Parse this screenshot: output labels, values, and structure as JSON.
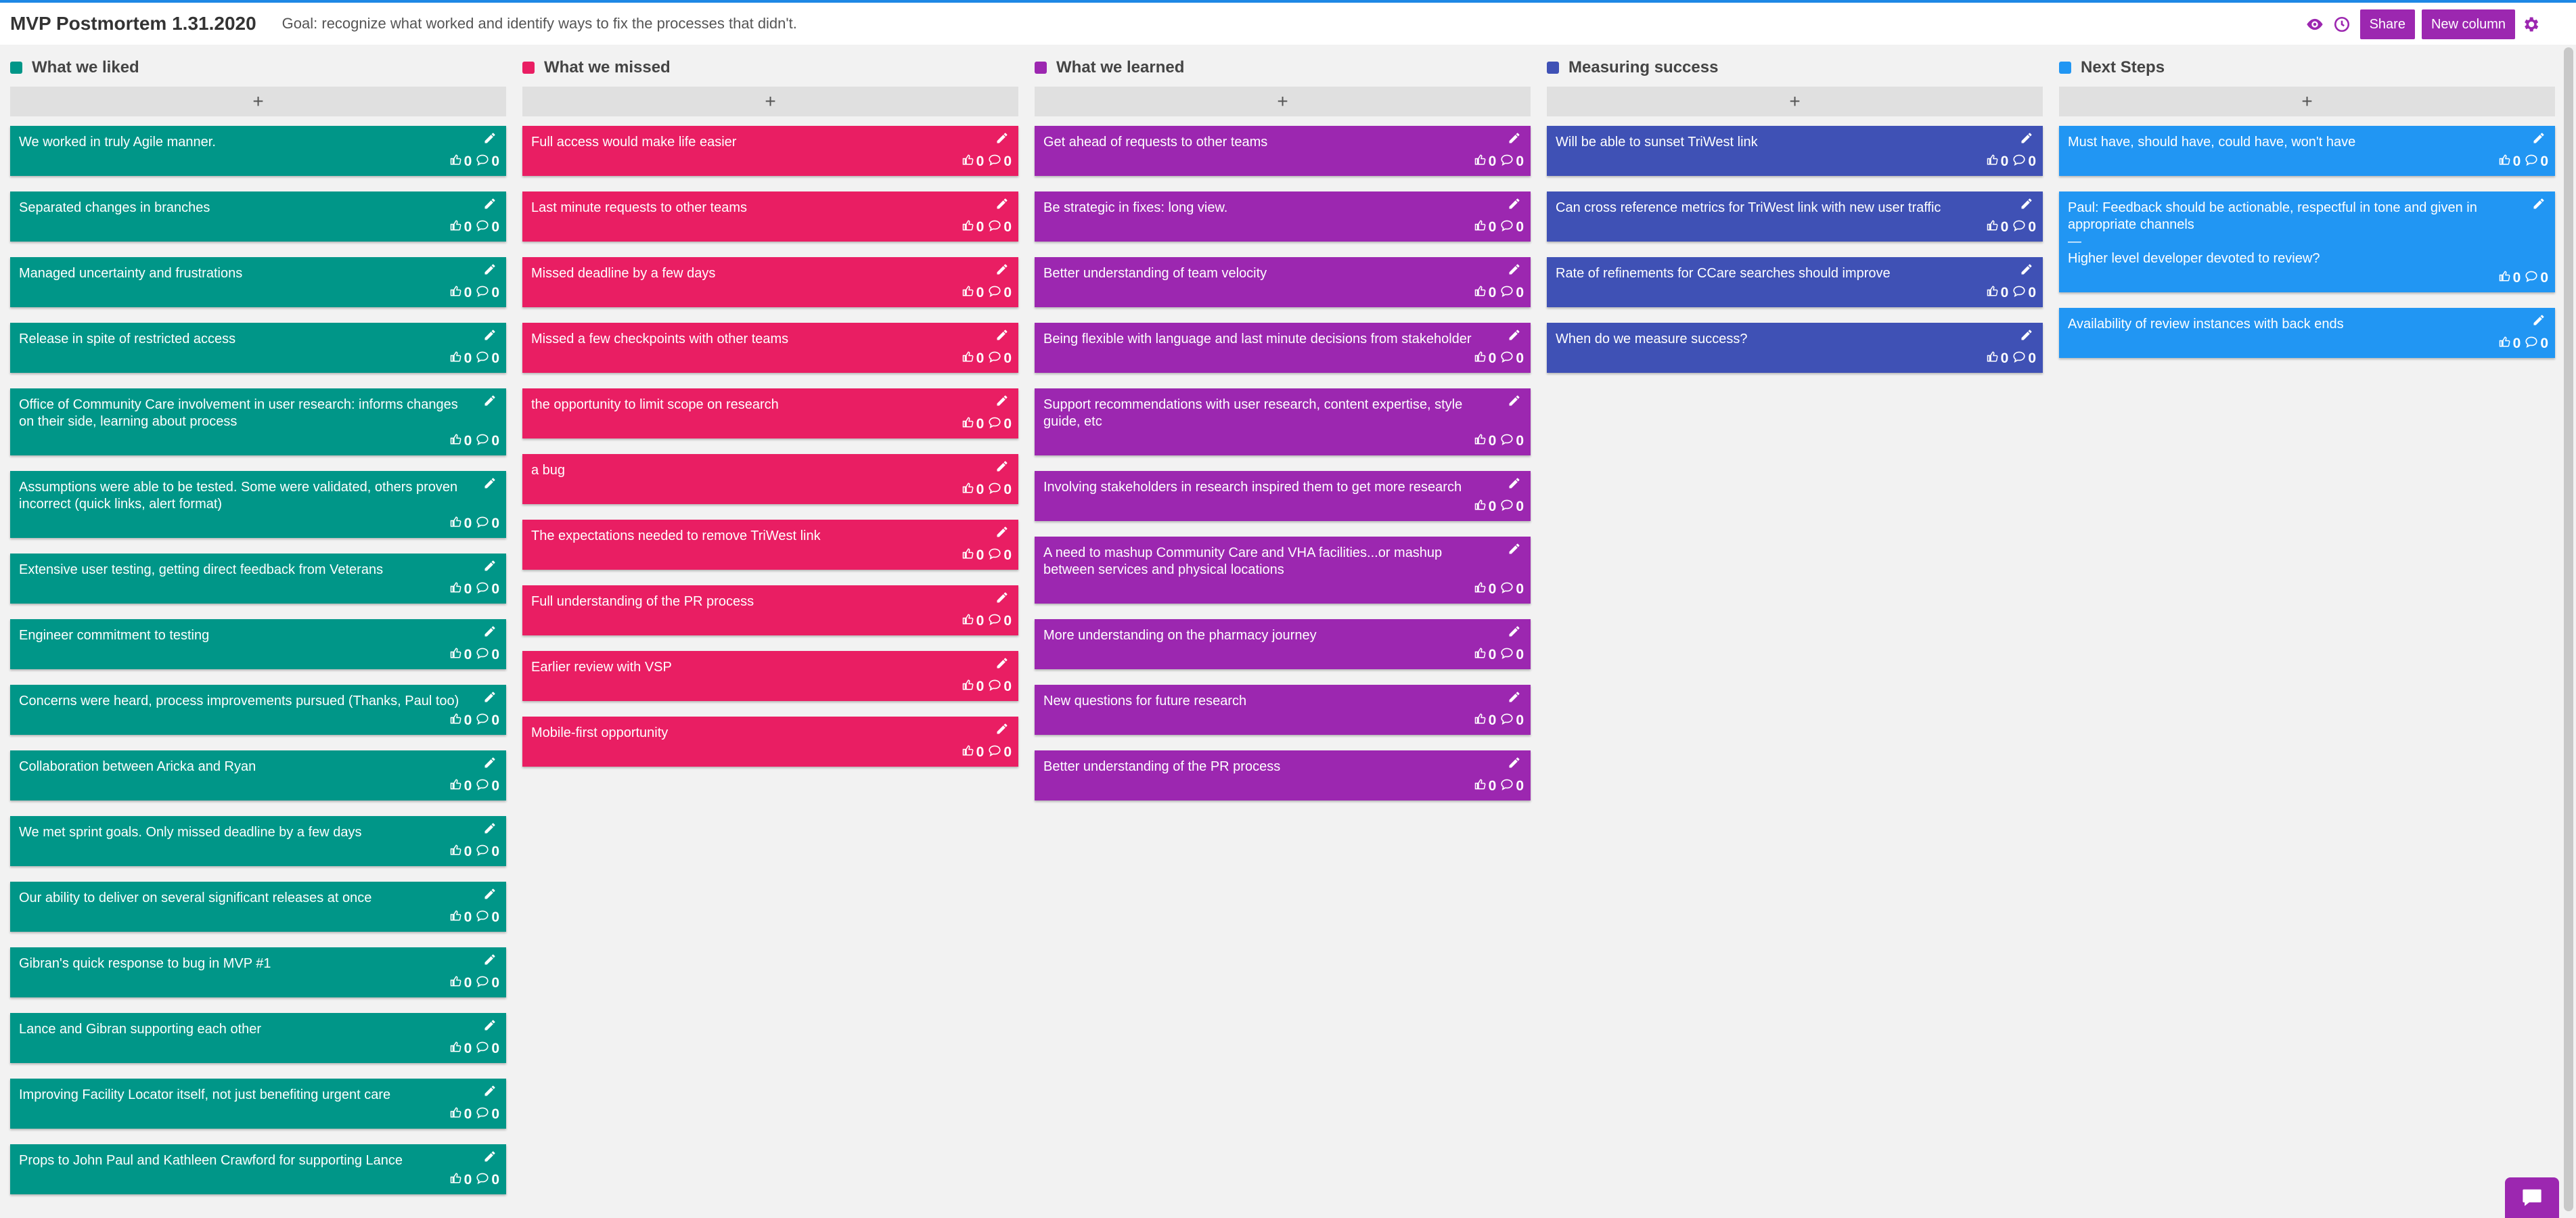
{
  "header": {
    "title": "MVP Postmortem 1.31.2020",
    "goal": "Goal: recognize what worked and identify ways to fix the processes that didn't.",
    "share_label": "Share",
    "new_column_label": "New column",
    "icons": [
      "eye-icon",
      "clock-icon",
      "gear-icon"
    ],
    "accent_color": "#9c27b0"
  },
  "add_label": "+",
  "columns": [
    {
      "title": "What we liked",
      "color": "#009688",
      "cards": [
        {
          "text": "We worked in truly Agile manner.",
          "likes": "0",
          "comments": "0"
        },
        {
          "text": "Separated changes in branches",
          "likes": "0",
          "comments": "0"
        },
        {
          "text": "Managed uncertainty and frustrations",
          "likes": "0",
          "comments": "0"
        },
        {
          "text": "Release in spite of restricted access",
          "likes": "0",
          "comments": "0"
        },
        {
          "text": "Office of Community Care involvement in user research: informs changes on their side, learning about process",
          "likes": "0",
          "comments": "0"
        },
        {
          "text": "Assumptions were able to be tested. Some were validated, others proven incorrect (quick links, alert format)",
          "likes": "0",
          "comments": "0"
        },
        {
          "text": "Extensive user testing, getting direct feedback from Veterans",
          "likes": "0",
          "comments": "0"
        },
        {
          "text": "Engineer commitment to testing",
          "likes": "0",
          "comments": "0"
        },
        {
          "text": "Concerns were heard, process improvements pursued (Thanks, Paul too)",
          "likes": "0",
          "comments": "0"
        },
        {
          "text": "Collaboration between Aricka and Ryan",
          "likes": "0",
          "comments": "0"
        },
        {
          "text": "We met sprint goals. Only missed deadline by a few days",
          "likes": "0",
          "comments": "0"
        },
        {
          "text": "Our ability to deliver on several significant releases at once",
          "likes": "0",
          "comments": "0"
        },
        {
          "text": "Gibran's quick response to bug in MVP #1",
          "likes": "0",
          "comments": "0"
        },
        {
          "text": "Lance and Gibran supporting each other",
          "likes": "0",
          "comments": "0"
        },
        {
          "text": "Improving Facility Locator itself, not just benefiting urgent care",
          "likes": "0",
          "comments": "0"
        },
        {
          "text": "Props to John Paul and Kathleen Crawford for supporting Lance",
          "likes": "0",
          "comments": "0"
        }
      ]
    },
    {
      "title": "What we missed",
      "color": "#e91e63",
      "cards": [
        {
          "text": "Full access would make life easier",
          "likes": "0",
          "comments": "0"
        },
        {
          "text": "Last minute requests to other teams",
          "likes": "0",
          "comments": "0"
        },
        {
          "text": "Missed deadline by a few days",
          "likes": "0",
          "comments": "0"
        },
        {
          "text": "Missed a few checkpoints with other teams",
          "likes": "0",
          "comments": "0"
        },
        {
          "text": "the opportunity to limit scope on research",
          "likes": "0",
          "comments": "0"
        },
        {
          "text": "a bug",
          "likes": "0",
          "comments": "0"
        },
        {
          "text": "The expectations needed to remove TriWest link",
          "likes": "0",
          "comments": "0"
        },
        {
          "text": "Full understanding of the PR process",
          "likes": "0",
          "comments": "0"
        },
        {
          "text": "Earlier review with VSP",
          "likes": "0",
          "comments": "0"
        },
        {
          "text": "Mobile-first opportunity",
          "likes": "0",
          "comments": "0"
        }
      ]
    },
    {
      "title": "What we learned",
      "color": "#9c27b0",
      "cards": [
        {
          "text": "Get ahead of requests to other teams",
          "likes": "0",
          "comments": "0"
        },
        {
          "text": "Be strategic in fixes: long view.",
          "likes": "0",
          "comments": "0"
        },
        {
          "text": "Better understanding of team velocity",
          "likes": "0",
          "comments": "0"
        },
        {
          "text": "Being flexible with language and last minute decisions from stakeholder",
          "likes": "0",
          "comments": "0"
        },
        {
          "text": "Support recommendations with user research, content expertise, style guide, etc",
          "likes": "0",
          "comments": "0"
        },
        {
          "text": "Involving stakeholders in research inspired them to get more research",
          "likes": "0",
          "comments": "0"
        },
        {
          "text": "A need to mashup Community Care and VHA facilities...or mashup between services and physical locations",
          "likes": "0",
          "comments": "0"
        },
        {
          "text": "More understanding on the pharmacy journey",
          "likes": "0",
          "comments": "0"
        },
        {
          "text": "New questions for future research",
          "likes": "0",
          "comments": "0"
        },
        {
          "text": "Better understanding of the PR process",
          "likes": "0",
          "comments": "0"
        }
      ]
    },
    {
      "title": "Measuring success",
      "color": "#3f51b5",
      "cards": [
        {
          "text": "Will be able to sunset TriWest link",
          "likes": "0",
          "comments": "0"
        },
        {
          "text": "Can cross reference metrics for TriWest link with new user traffic",
          "likes": "0",
          "comments": "0"
        },
        {
          "text": "Rate of refinements for CCare searches should improve",
          "likes": "0",
          "comments": "0"
        },
        {
          "text": "When do we measure success?",
          "likes": "0",
          "comments": "0"
        }
      ]
    },
    {
      "title": "Next Steps",
      "color": "#2196f3",
      "cards": [
        {
          "text": "Must have, should have, could have, won't have",
          "likes": "0",
          "comments": "0"
        },
        {
          "text": "Paul: Feedback should be actionable, respectful in tone and given in appropriate channels",
          "separator": "—",
          "subtext": "Higher level developer devoted to review?",
          "likes": "0",
          "comments": "0"
        },
        {
          "text": "Availability of review instances with back ends",
          "likes": "0",
          "comments": "0"
        }
      ]
    }
  ]
}
